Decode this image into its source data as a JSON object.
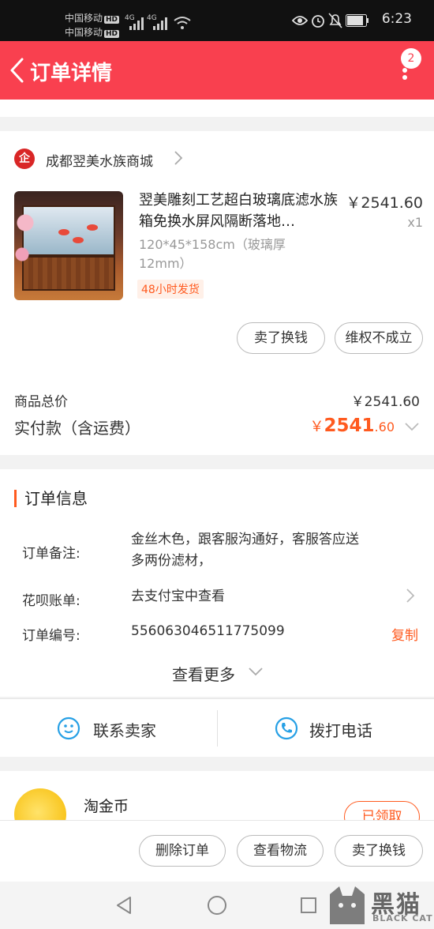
{
  "status_bar": {
    "carrier_1": "中国移动",
    "carrier_2": "中国移动",
    "hd_label": "HD",
    "network_1": "4G",
    "network_2": "4G",
    "time": "6:23"
  },
  "header": {
    "title": "订单详情",
    "badge_count": "2"
  },
  "shop": {
    "logo_char": "企",
    "name": "成都翌美水族商城"
  },
  "product": {
    "name": "翌美雕刻工艺超白玻璃底滤水族箱免换水屏风隔断落地…",
    "price": "￥2541.60",
    "quantity": "x1",
    "sku": "120*45*158cm（玻璃厚12mm）",
    "tag": "48小时发货"
  },
  "item_actions": {
    "sell_label": "卖了换钱",
    "rights_label": "维权不成立"
  },
  "summary": {
    "total_label": "商品总价",
    "total_value": "￥2541.60",
    "paid_label": "实付款（含运费）",
    "paid_currency": "￥",
    "paid_integer": "2541",
    "paid_decimal": ".60"
  },
  "order_info": {
    "section_title": "订单信息",
    "remark_label": "订单备注:",
    "remark_value": "金丝木色，跟客服沟通好，客服答应送多两份滤材，",
    "huabei_label": "花呗账单:",
    "huabei_value": "去支付宝中查看",
    "order_no_label": "订单编号:",
    "order_no_value": "556063046511775099",
    "copy_label": "复制",
    "see_more_label": "查看更多"
  },
  "contact": {
    "seller_label": "联系卖家",
    "phone_label": "拨打电话"
  },
  "coin": {
    "title": "淘金币",
    "claimed_label": "已领取"
  },
  "bottom_actions": {
    "delete_label": "删除订单",
    "logistics_label": "查看物流",
    "sell_label": "卖了换钱"
  },
  "watermark": {
    "cn": "黑猫",
    "en": "BLACK CAT"
  },
  "colors": {
    "header_bg": "#f9404f",
    "accent_orange": "#ff5a1f",
    "contact_blue": "#27a0e5"
  }
}
